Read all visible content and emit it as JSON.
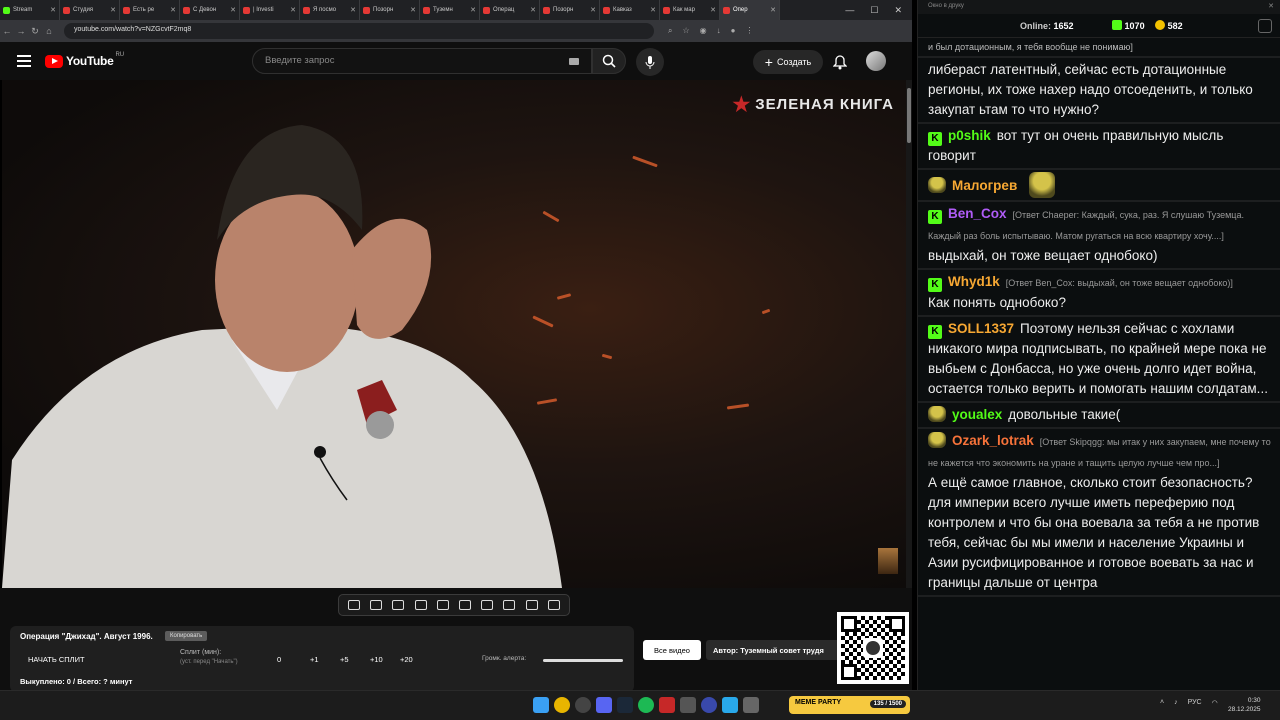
{
  "browser": {
    "tabs": [
      {
        "label": "Stream",
        "icon": "kick-icon"
      },
      {
        "label": "Студия",
        "icon": "youtube-icon"
      },
      {
        "label": "Есть ре",
        "icon": "youtube-icon"
      },
      {
        "label": "С Девон",
        "icon": "youtube-icon"
      },
      {
        "label": "| Investi",
        "icon": "youtube-icon"
      },
      {
        "label": "Я посмо",
        "icon": "youtube-icon"
      },
      {
        "label": "Позорн",
        "icon": "youtube-icon"
      },
      {
        "label": "Туземн",
        "icon": "youtube-icon"
      },
      {
        "label": "Операц",
        "icon": "youtube-icon"
      },
      {
        "label": "Позорн",
        "icon": "youtube-icon"
      },
      {
        "label": "Кавказ",
        "icon": "youtube-icon"
      },
      {
        "label": "Как мар",
        "icon": "youtube-icon"
      },
      {
        "label": "Опер",
        "icon": "youtube-icon",
        "active": true
      }
    ],
    "url": "youtube.com/watch?v=NZGcvtF2mq8"
  },
  "youtube": {
    "logo": "YouTube",
    "region": "RU",
    "search_placeholder": "Введите запрос",
    "create_label": "Создать"
  },
  "video": {
    "watermark": "ЗЕЛЕНАЯ КНИГА"
  },
  "extension": {
    "title": "Операция \"Джихад\". Август 1996.",
    "copy_label": "Копировать",
    "start_split": "НАЧАТЬ СПЛИТ",
    "split_label": "Сплит (мин):",
    "split_hint": "(уст. перед \"Начать\")",
    "split_values": [
      "0",
      "+1",
      "+5",
      "+10",
      "+20"
    ],
    "alert_volume_label": "Громк. алерта:",
    "bought": "Выкуплено: 0 / Всего: ? минут",
    "all_videos": "Все видео",
    "author": "Автор: Туземный совет трудя"
  },
  "chat": {
    "popout_title": "Окно в друку",
    "online_label": "Online:",
    "online_count": "1652",
    "kick_count": "1070",
    "gold_count": "582",
    "messages": [
      {
        "nick": "",
        "reply": "",
        "text": "и был дотационным, я тебя вообще не понимаю]",
        "small": true
      },
      {
        "nick": "",
        "reply": "",
        "text": "либераст латентный, сейчас есть дотационные регионы, их тоже нахер надо отсоеденить, и только закупат ьтам то что нужно?"
      },
      {
        "nick": "p0shik",
        "color": "#53fc18",
        "badge": "kick",
        "reply": "",
        "text": "вот тут он очень правильную мысль говорит"
      },
      {
        "nick": "Малогрев",
        "color": "#f7a833",
        "badge": "emote",
        "reply": "",
        "text": "",
        "emote_after": true
      },
      {
        "nick": "Ben_Cox",
        "color": "#b05cf7",
        "badge": "kick",
        "reply": "[Ответ Chaeper: Каждый, сука, раз. Я слушаю Туземца. Каждый раз боль испытываю. Матом ругаться на всю квартиру хочу....]",
        "text": "выдыхай, он тоже вещает однобоко)"
      },
      {
        "nick": "Whyd1k",
        "color": "#f7a833",
        "badge": "kick",
        "reply": "[Ответ Ben_Cox: выдыхай, он тоже вещает однобоко)]",
        "text": "Как понять однобоко?"
      },
      {
        "nick": "SOLL1337",
        "color": "#f7a833",
        "badge": "kick",
        "reply": "",
        "text": "Поэтому нельзя сейчас с хохлами никакого мира подписывать, по крайней мере пока не выбьем с Донбасса, но уже очень долго идет война, остается только верить и помогать нашим солдатам..."
      },
      {
        "nick": "youalex",
        "color": "#53fc18",
        "badge": "emote",
        "reply": "",
        "text": "довольные такие("
      },
      {
        "nick": "Ozark_lotrak",
        "color": "#f7733a",
        "badge": "emote",
        "reply": "[Ответ Skipqgg: мы итак у них закупаем, мне почему то не кажется что экономить на уране и тащить целую лучше чем про...]",
        "text": "А ещё самое главное, сколько стоит безопасность? для империи всего лучше иметь переферию под контролем и что бы она воевала за тебя а не против тебя, сейчас бы мы имели и население Украины и Азии русифицированное и готовое воевать за нас и границы дальше от центра"
      }
    ]
  },
  "taskbar": {
    "widget_label": "МЕМЕ PARTY",
    "widget_counter": "135 / 1500",
    "lang": "РУС",
    "time": "0:30",
    "date": "28.12.2025"
  }
}
